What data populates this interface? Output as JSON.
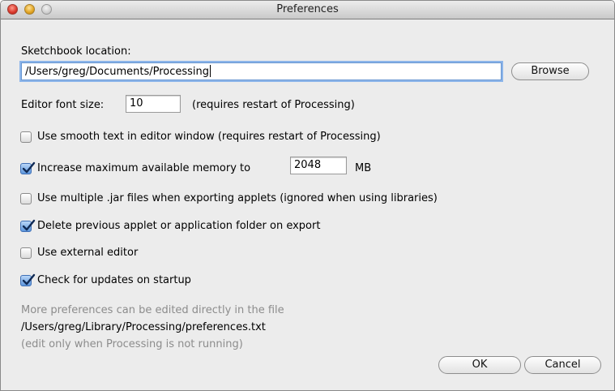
{
  "window": {
    "title": "Preferences"
  },
  "sketchbook": {
    "label": "Sketchbook location:",
    "path": "/Users/greg/Documents/Processing",
    "browse_label": "Browse"
  },
  "font_size": {
    "label": "Editor font size:",
    "value": "10",
    "note": "(requires restart of Processing)"
  },
  "options": [
    {
      "label": "Use smooth text in editor window (requires restart of Processing)",
      "checked": false
    },
    {
      "label": "Increase maximum available memory to",
      "checked": true
    },
    {
      "label": "Use multiple .jar files when exporting applets (ignored when using libraries)",
      "checked": false
    },
    {
      "label": "Delete previous applet or application folder on export",
      "checked": true
    },
    {
      "label": "Use external editor",
      "checked": false
    },
    {
      "label": "Check for updates on startup",
      "checked": true
    }
  ],
  "memory": {
    "value": "2048",
    "unit": "MB"
  },
  "footer": {
    "note1": "More preferences can be edited directly in the file",
    "prefs_path": "/Users/greg/Library/Processing/preferences.txt",
    "note2": "(edit only when Processing is not running)"
  },
  "buttons": {
    "ok_label": "OK",
    "cancel_label": "Cancel"
  },
  "colors": {
    "focus_ring": "#8cb5ea",
    "checkbox_checked": "#5c96dc",
    "muted_text": "#8c8c8c"
  }
}
